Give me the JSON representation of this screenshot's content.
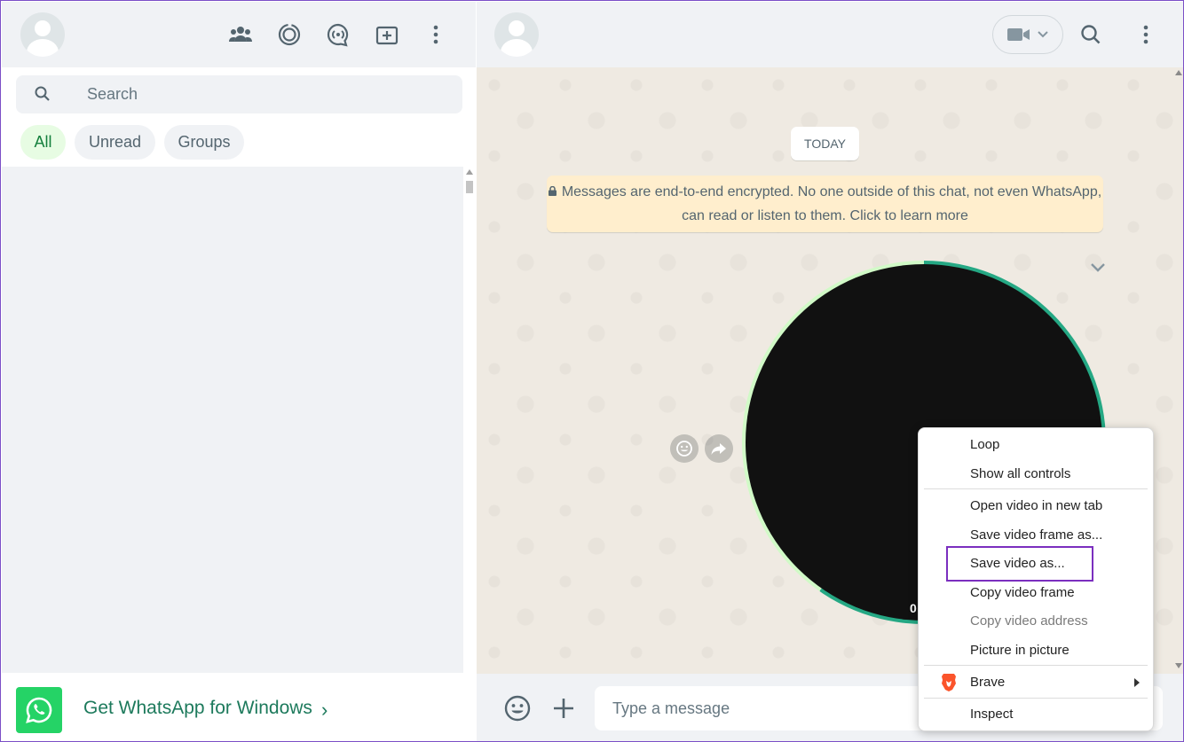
{
  "left": {
    "search": {
      "placeholder": "Search"
    },
    "filters": [
      {
        "label": "All",
        "active": true
      },
      {
        "label": "Unread",
        "active": false
      },
      {
        "label": "Groups",
        "active": false
      }
    ],
    "promo": {
      "label": "Get WhatsApp for Windows",
      "chevron": "›"
    },
    "header_icons": [
      "communities-icon",
      "status-icon",
      "channels-icon",
      "new-chat-icon",
      "menu-icon"
    ]
  },
  "chat": {
    "date_label": "TODAY",
    "encryption_notice": "Messages are end-to-end encrypted. No one outside of this chat, not even WhatsApp, can read or listen to them. Click to learn more",
    "video_time": "0:",
    "composer_placeholder": "Type a message",
    "header_icons": [
      "video-call-icon",
      "search-icon",
      "menu-icon"
    ]
  },
  "context_menu": {
    "items": [
      {
        "label": "Loop"
      },
      {
        "label": "Show all controls"
      },
      {
        "label": "Open video in new tab"
      },
      {
        "label": "Save video frame as..."
      },
      {
        "label": "Save video as..."
      },
      {
        "label": "Copy video frame"
      },
      {
        "label": "Copy video address",
        "disabled": true
      },
      {
        "label": "Picture in picture"
      },
      {
        "label": "Brave"
      },
      {
        "label": "Inspect"
      }
    ]
  },
  "colors": {
    "accent_green": "#25d366",
    "progress_ring": "#25a884",
    "highlight_border": "#7b2fbf"
  }
}
